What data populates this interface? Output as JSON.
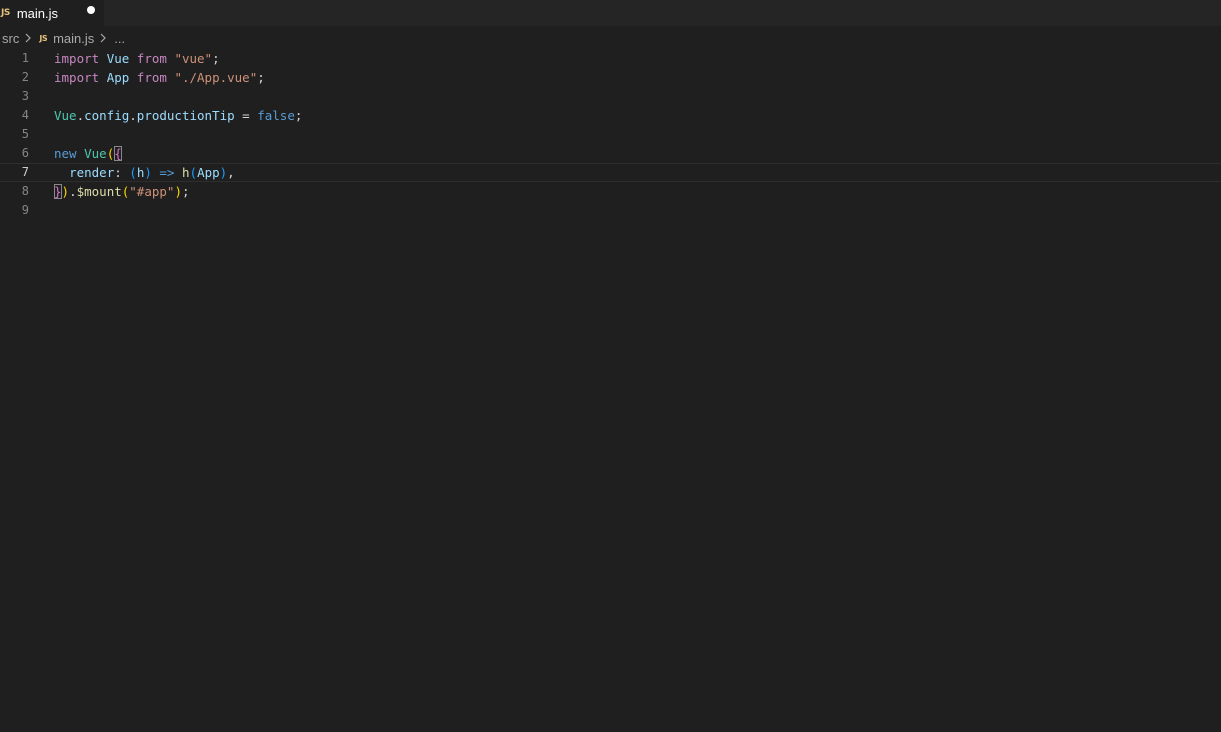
{
  "tab": {
    "language_badge": "JS",
    "filename": "main.js",
    "modified": true
  },
  "breadcrumb": {
    "folder": "src",
    "file_badge": "JS",
    "file": "main.js",
    "ellipsis": "..."
  },
  "editor": {
    "line_numbers": [
      "1",
      "2",
      "3",
      "4",
      "5",
      "6",
      "7",
      "8",
      "9"
    ],
    "current_line": 7,
    "tokens": {
      "l1": [
        "import",
        " ",
        "Vue",
        " ",
        "from",
        " ",
        "\"vue\"",
        ";"
      ],
      "l2": [
        "import",
        " ",
        "App",
        " ",
        "from",
        " ",
        "\"./App.vue\"",
        ";"
      ],
      "l4": [
        "Vue",
        ".",
        "config",
        ".",
        "productionTip",
        " = ",
        "false",
        ";"
      ],
      "l6": [
        "new",
        " ",
        "Vue",
        "(",
        "{"
      ],
      "l7": [
        "  ",
        "render",
        ": ",
        "(",
        "h",
        ")",
        " ",
        "=>",
        " ",
        "h",
        "(",
        "App",
        ")",
        ","
      ],
      "l8": [
        "}",
        ")",
        ".",
        "$mount",
        "(",
        "\"#app\"",
        ")",
        ";"
      ]
    }
  },
  "colors": {
    "background": "#1f1f1f",
    "keyword": "#c586c0",
    "class": "#4ec9b0",
    "variable": "#9cdcfe",
    "function": "#dcdcaa",
    "string": "#ce9178",
    "constant": "#569cd6",
    "bracket_gold": "#ffd700"
  },
  "icons": {
    "breadcrumb_separator": "chevron-right-icon",
    "tab_modified": "dot-icon"
  }
}
